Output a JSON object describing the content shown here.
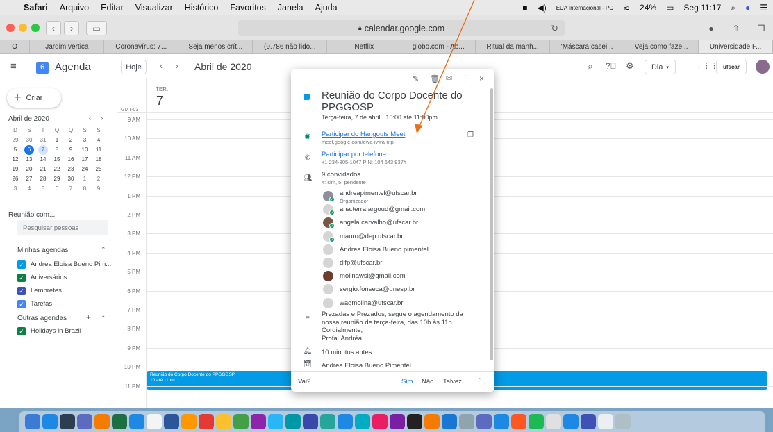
{
  "menubar": {
    "apple": "",
    "app": "Safari",
    "items": [
      "Arquivo",
      "Editar",
      "Visualizar",
      "Histórico",
      "Favoritos",
      "Janela",
      "Ajuda"
    ],
    "input_source": "EUA Internacional - PC",
    "battery": "24%",
    "clock": "Seg 11:17"
  },
  "safari": {
    "url": "calendar.google.com",
    "tabs": [
      "O",
      "Jardim vertica",
      "Coronavírus: 7...",
      "Seja menos crít...",
      "(9.786 não lido...",
      "Netflix",
      "globo.com - Ab...",
      "Ritual da manh...",
      "'Máscara casei...",
      "Veja como faze...",
      "Universidade F..."
    ]
  },
  "calendar_header": {
    "app_name": "Agenda",
    "logo_day": "6",
    "today_button": "Hoje",
    "period": "Abril de 2020",
    "view_select": "Dia",
    "org_logo": "ufscar"
  },
  "sidebar": {
    "create_label": "Criar",
    "mini_month": "Abril de 2020",
    "weekdays": [
      "D",
      "S",
      "T",
      "Q",
      "Q",
      "S",
      "S"
    ],
    "days": [
      "29",
      "30",
      "31",
      "1",
      "2",
      "3",
      "4",
      "5",
      "6",
      "7",
      "8",
      "9",
      "10",
      "11",
      "12",
      "13",
      "14",
      "15",
      "16",
      "17",
      "18",
      "19",
      "20",
      "21",
      "22",
      "23",
      "24",
      "25",
      "26",
      "27",
      "28",
      "29",
      "30",
      "1",
      "2",
      "3",
      "4",
      "5",
      "6",
      "7",
      "8",
      "9"
    ],
    "meeting_with": "Reunião com...",
    "search_people": "Pesquisar pessoas",
    "my_calendars_title": "Minhas agendas",
    "my_calendars": [
      {
        "label": "Andrea Eloisa Bueno Pim...",
        "color": "#039be5"
      },
      {
        "label": "Aniversários",
        "color": "#0b8043"
      },
      {
        "label": "Lembretes",
        "color": "#3f51b5"
      },
      {
        "label": "Tarefas",
        "color": "#4285f4"
      }
    ],
    "other_calendars_title": "Outras agendas",
    "other_calendars": [
      {
        "label": "Holidays in Brazil",
        "color": "#0b8043"
      }
    ]
  },
  "day_view": {
    "weekday": "TER.",
    "day": "7",
    "timezone": "GMT-03",
    "hours": [
      "9 AM",
      "10 AM",
      "11 AM",
      "12 PM",
      "1 PM",
      "2 PM",
      "3 PM",
      "4 PM",
      "5 PM",
      "6 PM",
      "7 PM",
      "8 PM",
      "9 PM",
      "10 PM",
      "11 PM"
    ],
    "event_title": "Reunião do Corpo Docente do PPGGOSP",
    "event_time": "10 até 11pm"
  },
  "popup": {
    "title": "Reunião do Corpo Docente do PPGGOSP",
    "date_line": "Terça-feira, 7 de abril  ·  10:00 até 11:00pm",
    "hangouts_label": "Participar do Hangouts Meet",
    "hangouts_link": "meet.google.com/ewa-ivwa-ntp",
    "phone_label": "Participar por telefone",
    "phone_detail": "+1 234-805-1047 PIN: 104 643 937#",
    "guests_count": "9 convidados",
    "guests_detail": "4: sim, 5: pendente",
    "guests": [
      {
        "email": "andreapimentel@ufscar.br",
        "sub": "Organizador",
        "avatar": "#8e8e9c",
        "check": true
      },
      {
        "email": "ana.terra.argoud@gmail.com",
        "sub": "",
        "avatar": "#d5d5d5",
        "check": true
      },
      {
        "email": "angela.carvalho@ufscar.br",
        "sub": "",
        "avatar": "#7a5848",
        "check": true
      },
      {
        "email": "mauro@dep.ufscar.br",
        "sub": "",
        "avatar": "#d5d5d5",
        "check": true
      },
      {
        "email": "Andrea Eloisa Bueno pimentel",
        "sub": "",
        "avatar": "#d5d5d5",
        "check": false
      },
      {
        "email": "dlfp@ufscar.br",
        "sub": "",
        "avatar": "#d5d5d5",
        "check": false
      },
      {
        "email": "molinawsl@gmail.com",
        "sub": "",
        "avatar": "#6b3e2e",
        "check": false
      },
      {
        "email": "sergio.fonseca@unesp.br",
        "sub": "",
        "avatar": "#d5d5d5",
        "check": false
      },
      {
        "email": "wagmolina@ufscar.br",
        "sub": "",
        "avatar": "#d5d5d5",
        "check": false
      }
    ],
    "description": [
      "Prezadas e Prezados, segue o agendamento da",
      "nossa reunião de terça-feira, das 10h às 11h.",
      "Cordialmente,",
      "Profa. Andréa"
    ],
    "reminder": "10 minutos antes",
    "calendar_owner": "Andrea Eloisa Bueno Pimentel",
    "rsvp_question": "Vai?",
    "rsvp_yes": "Sim",
    "rsvp_no": "Não",
    "rsvp_maybe": "Talvez"
  },
  "colors": {
    "event_blue": "#039be5",
    "link_blue": "#1a73e8",
    "annotation_arrow": "#e8711a"
  }
}
